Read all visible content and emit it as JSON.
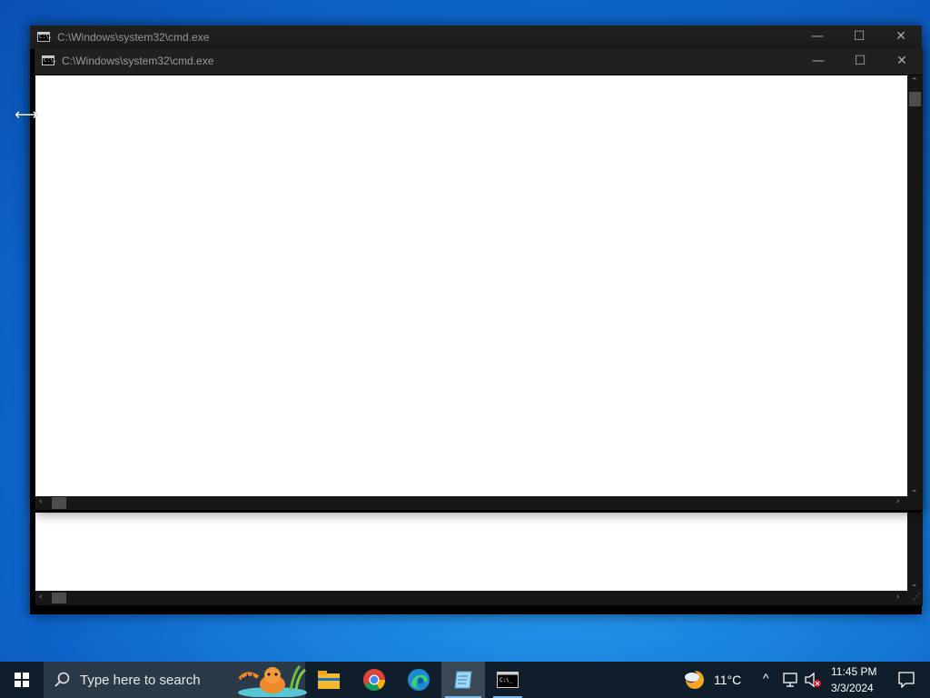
{
  "back_window": {
    "title": "C:\\Windows\\system32\\cmd.exe",
    "icon_text": "C:\\."
  },
  "front_window": {
    "title": "C:\\Windows\\system32\\cmd.exe",
    "icon_text": "C:\\."
  },
  "taskbar": {
    "search_placeholder": "Type here to search",
    "weather_temp": "11°C",
    "time": "11:45 PM",
    "date": "3/3/2024",
    "apps": [
      "file-explorer",
      "chrome",
      "edge",
      "notepad",
      "command-prompt"
    ]
  },
  "colors": {
    "desktop": "#1b86e0",
    "titlebar": "#202020",
    "taskbar": "#0f1e2a",
    "console_bg": "#ffffff"
  }
}
